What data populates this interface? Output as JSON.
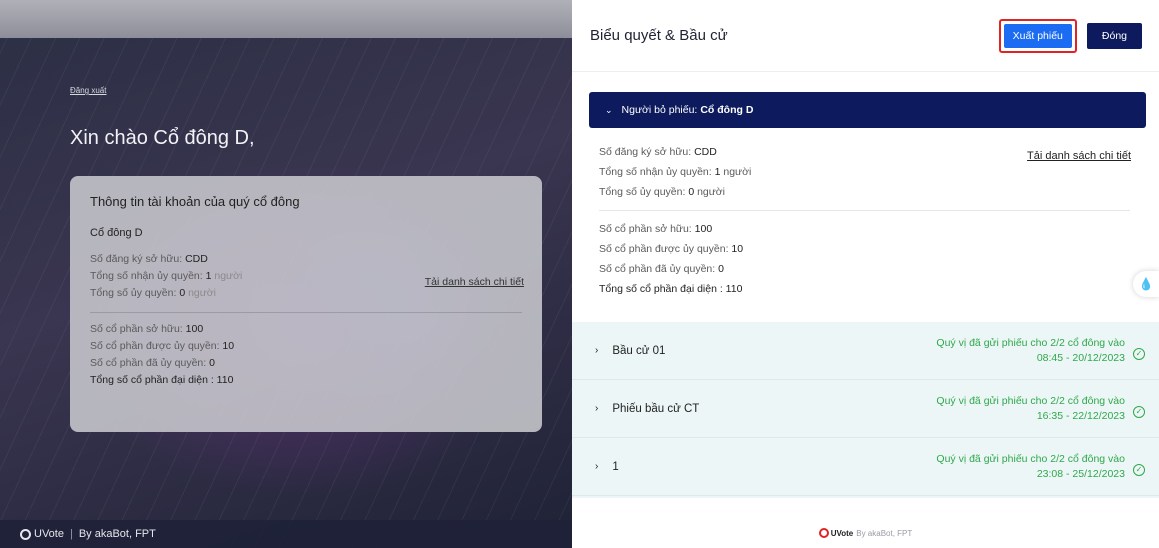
{
  "left": {
    "logout_label": "Đăng xuất",
    "greeting": "Xin chào Cổ đông D,",
    "account_card": {
      "title": "Thông tin tài khoản của quý cổ đông",
      "shareholder_name": "Cổ đông D",
      "reg_label": "Số đăng ký sở hữu: ",
      "reg_value": "CDD",
      "received_label": "Tổng số nhận ủy quyền: ",
      "received_value": "1",
      "received_unit": " người",
      "delegated_label": "Tổng số ủy quyền: ",
      "delegated_value": "0",
      "delegated_unit": " người",
      "detail_link": "Tải danh sách chi tiết",
      "owned_label": "Số cổ phần sở hữu: ",
      "owned_value": "100",
      "auth_in_label": "Số cổ phần được ủy quyền: ",
      "auth_in_value": "10",
      "auth_out_label": "Số cổ phần đã ủy quyền: ",
      "auth_out_value": "0",
      "total_label": "Tổng số cổ phần đại diện : ",
      "total_value": "110"
    },
    "footer": {
      "brand": "UVote",
      "byline": "By akaBot, FPT"
    }
  },
  "panel": {
    "title": "Biểu quyết & Bầu cử",
    "export_button": "Xuất phiếu",
    "close_button": "Đóng",
    "voter": {
      "label": "Người bỏ phiếu: ",
      "name": "Cổ đông D"
    },
    "details": {
      "reg_label": "Số đăng ký sở hữu: ",
      "reg_value": "CDD",
      "received_label": "Tổng số nhận ủy quyền: ",
      "received_value": "1",
      "received_unit": " người",
      "delegated_label": "Tổng số ủy quyền: ",
      "delegated_value": "0",
      "delegated_unit": " người",
      "detail_link": "Tải danh sách chi tiết",
      "owned_label": "Số cổ phần sở hữu: ",
      "owned_value": "100",
      "auth_in_label": "Số cổ phần được ủy quyền: ",
      "auth_in_value": "10",
      "auth_out_label": "Số cổ phần đã ủy quyền: ",
      "auth_out_value": "0",
      "total_label": "Tổng số cổ phần đại diện : ",
      "total_value": "110"
    },
    "elections": [
      {
        "name": "Bầu cử 01",
        "status_line1": "Quý vị đã gửi phiếu cho 2/2 cổ đông vào",
        "status_line2": "08:45 - 20/12/2023"
      },
      {
        "name": "Phiếu bầu cử CT",
        "status_line1": "Quý vị đã gửi phiếu cho 2/2 cổ đông vào",
        "status_line2": "16:35 - 22/12/2023"
      },
      {
        "name": "1",
        "status_line1": "Quý vị đã gửi phiếu cho 2/2 cổ đông vào",
        "status_line2": "23:08 - 25/12/2023"
      }
    ],
    "footer": {
      "brand": "UVote",
      "byline": "By akaBot, FPT"
    }
  },
  "colors": {
    "navy": "#0d1b5e",
    "accent_blue": "#1b6cf2",
    "highlight_red": "#e02424",
    "success_green": "#2ea84c"
  }
}
